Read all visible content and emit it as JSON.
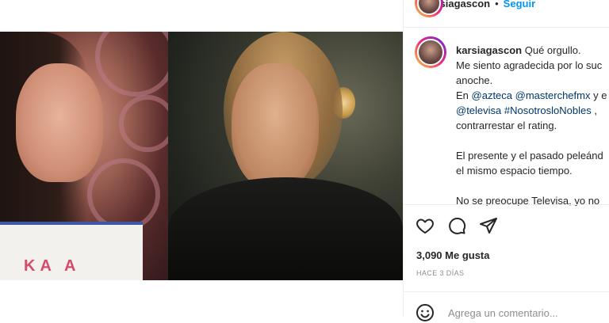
{
  "post": {
    "username": "karsiagascon",
    "follow_label": "Seguir",
    "caption_lines": [
      [
        "Qué orgullo."
      ],
      [
        "Me siento agradecida por lo suc"
      ],
      [
        "anoche."
      ],
      [
        "En ",
        "@azteca",
        " ",
        "@masterchefmx",
        " y e"
      ],
      [
        "@televisa",
        " ",
        "#NosotrosloNobles",
        " ,"
      ],
      [
        "contrarrestar el rating."
      ],
      [
        ""
      ],
      [
        "El presente y el pasado peleánd"
      ],
      [
        "el mismo espacio tiempo."
      ],
      [
        ""
      ],
      [
        "No se preocupe Televisa, yo no"
      ]
    ],
    "apron_text": "KA A",
    "likes": "3,090 Me gusta",
    "time_ago": "HACE 3 DÍAS",
    "comment_placeholder": "Agrega un comentario..."
  },
  "colors": {
    "link": "#00376b",
    "follow": "#0095f6",
    "text": "#262626",
    "muted": "#8e8e8e"
  },
  "icons": [
    "heart-icon",
    "comment-icon",
    "share-icon",
    "emoji-icon"
  ]
}
